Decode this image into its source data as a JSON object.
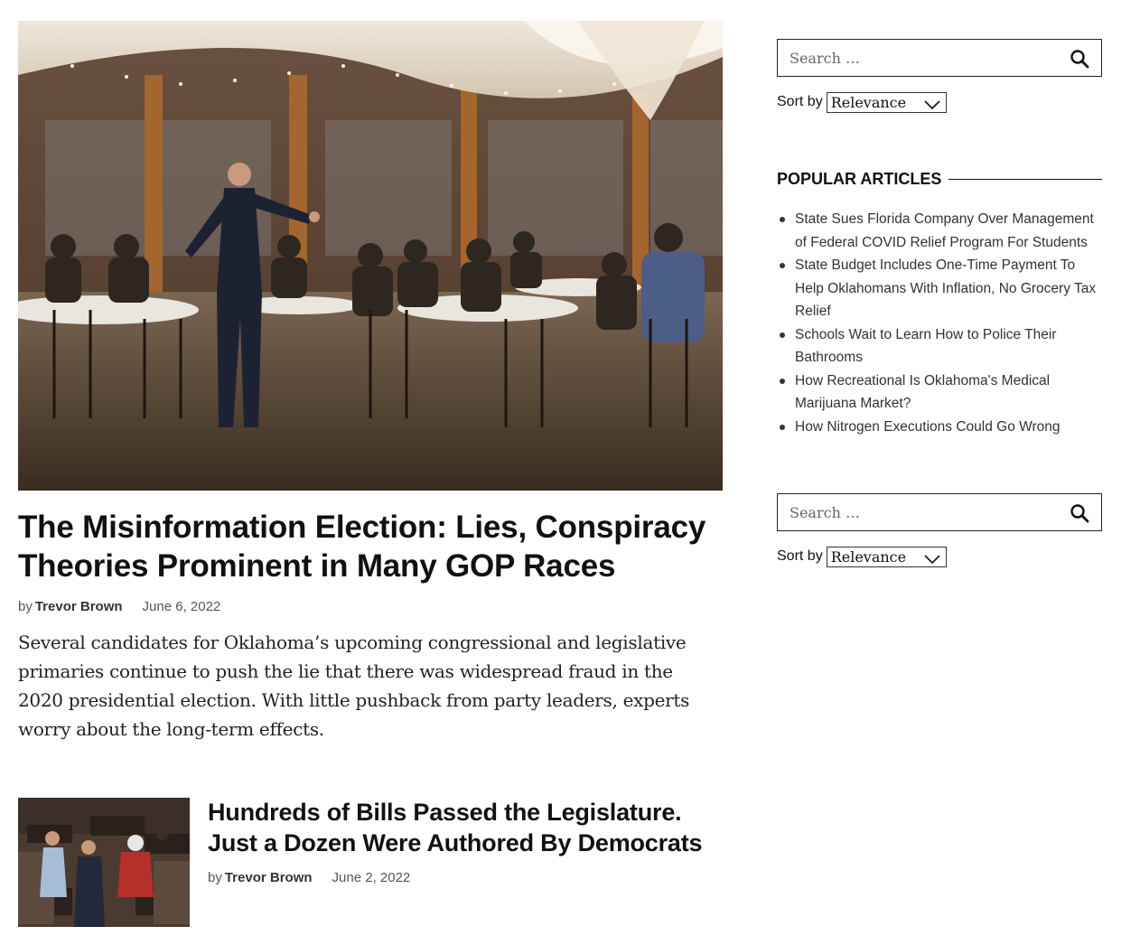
{
  "hero": {
    "image_alt": "Speaker addressing seated audience in event hall",
    "title": "The Misinformation Election: Lies, Conspiracy Theories Prominent in Many GOP Races",
    "by_label": "by",
    "author": "Trevor Brown",
    "date": "June 6, 2022",
    "excerpt": "Several candidates for Oklahoma’s upcoming congressional and legislative primaries continue to push the lie that there was widespread fraud in the 2020 presidential election. With little pushback from party leaders, experts worry about the long-term effects."
  },
  "card": {
    "image_alt": "Legislators on the chamber floor",
    "title": "Hundreds of Bills Passed the Legislature. Just a Dozen Were Authored By Democrats",
    "by_label": "by",
    "author": "Trevor Brown",
    "date": "June 2, 2022"
  },
  "sidebar": {
    "search_top": {
      "placeholder": "Search …",
      "icon": "search-icon"
    },
    "sort_top": {
      "label": "Sort by",
      "value": "Relevance"
    },
    "popular": {
      "title": "POPULAR ARTICLES",
      "items": [
        "State Sues Florida Company Over Management of Federal COVID Relief Program For Students",
        "State Budget Includes One-Time Payment To Help Oklahomans With Inflation, No Grocery Tax Relief",
        "Schools Wait to Learn How to Police Their Bathrooms",
        "How Recreational Is Oklahoma's Medical Marijuana Market?",
        "How Nitrogen Executions Could Go Wrong"
      ]
    },
    "search_bottom": {
      "placeholder": "Search …",
      "icon": "search-icon"
    },
    "sort_bottom": {
      "label": "Sort by",
      "value": "Relevance"
    }
  }
}
